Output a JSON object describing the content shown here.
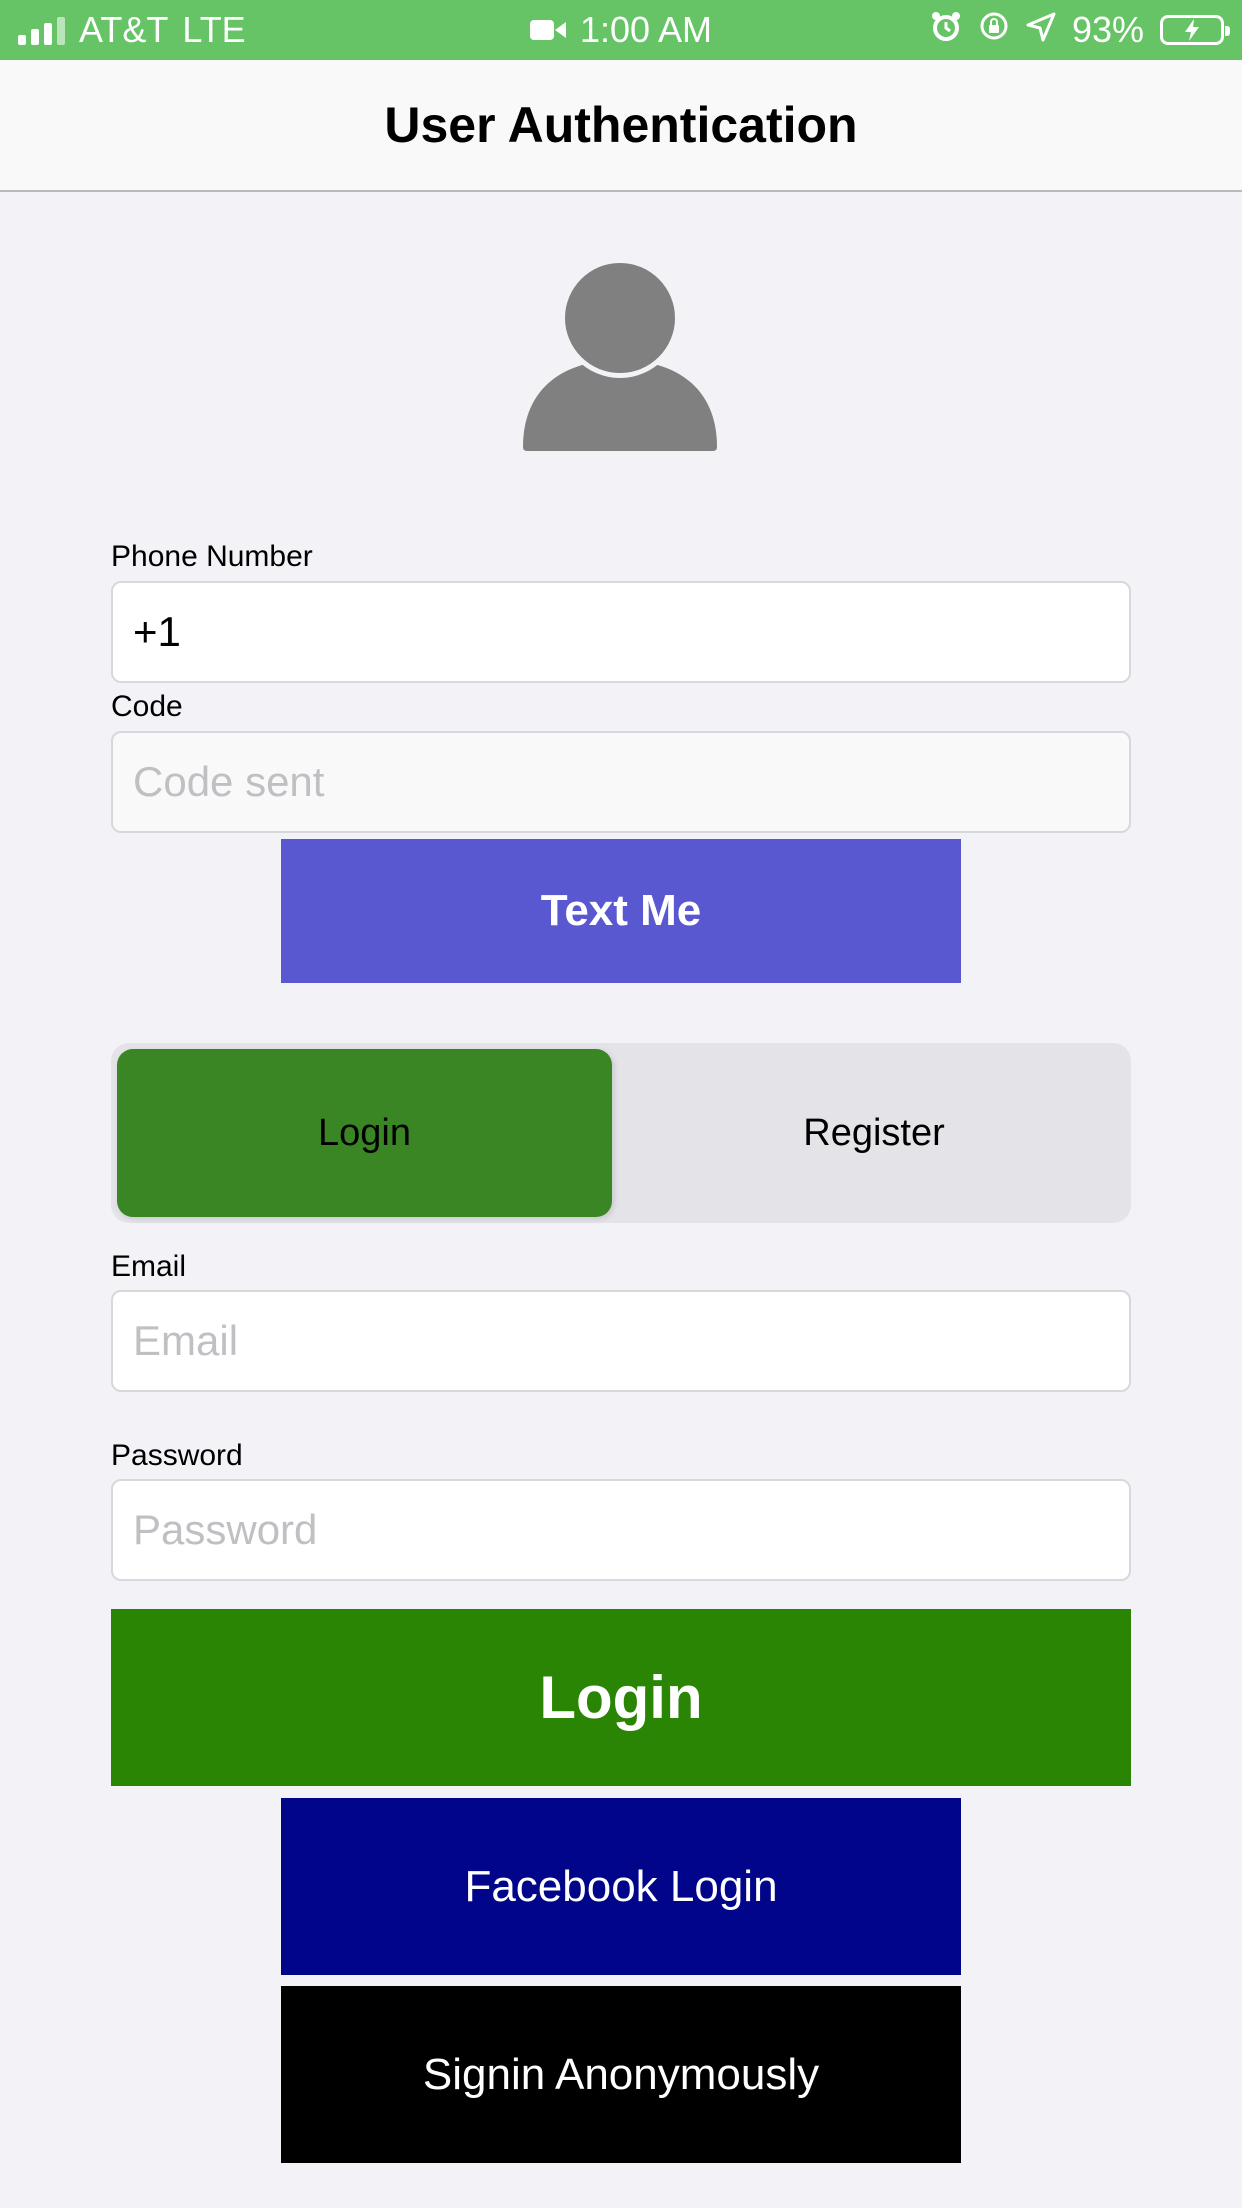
{
  "status_bar": {
    "carrier": "AT&T",
    "network": "LTE",
    "time": "1:00 AM",
    "battery": "93%",
    "icons": [
      "signal-icon",
      "video-camera-icon",
      "alarm-icon",
      "rotation-lock-icon",
      "location-arrow-icon",
      "battery-charging-icon"
    ],
    "background_color": "#66c467"
  },
  "nav": {
    "title": "User Authentication"
  },
  "phone": {
    "label": "Phone Number",
    "value": "+1"
  },
  "code": {
    "label": "Code",
    "placeholder": "Code sent"
  },
  "text_me_button": {
    "label": "Text Me",
    "color": "#5a58d0"
  },
  "segmented_control": {
    "options": [
      "Login",
      "Register"
    ],
    "selected": "Login",
    "selected_color": "#3a8624"
  },
  "email": {
    "label": "Email",
    "placeholder": "Email"
  },
  "password": {
    "label": "Password",
    "placeholder": "Password"
  },
  "login_button": {
    "label": "Login",
    "color": "#2a8505"
  },
  "facebook_button": {
    "label": "Facebook Login",
    "color": "#00058a"
  },
  "anonymous_button": {
    "label": "Signin Anonymously",
    "color": "#000000"
  }
}
